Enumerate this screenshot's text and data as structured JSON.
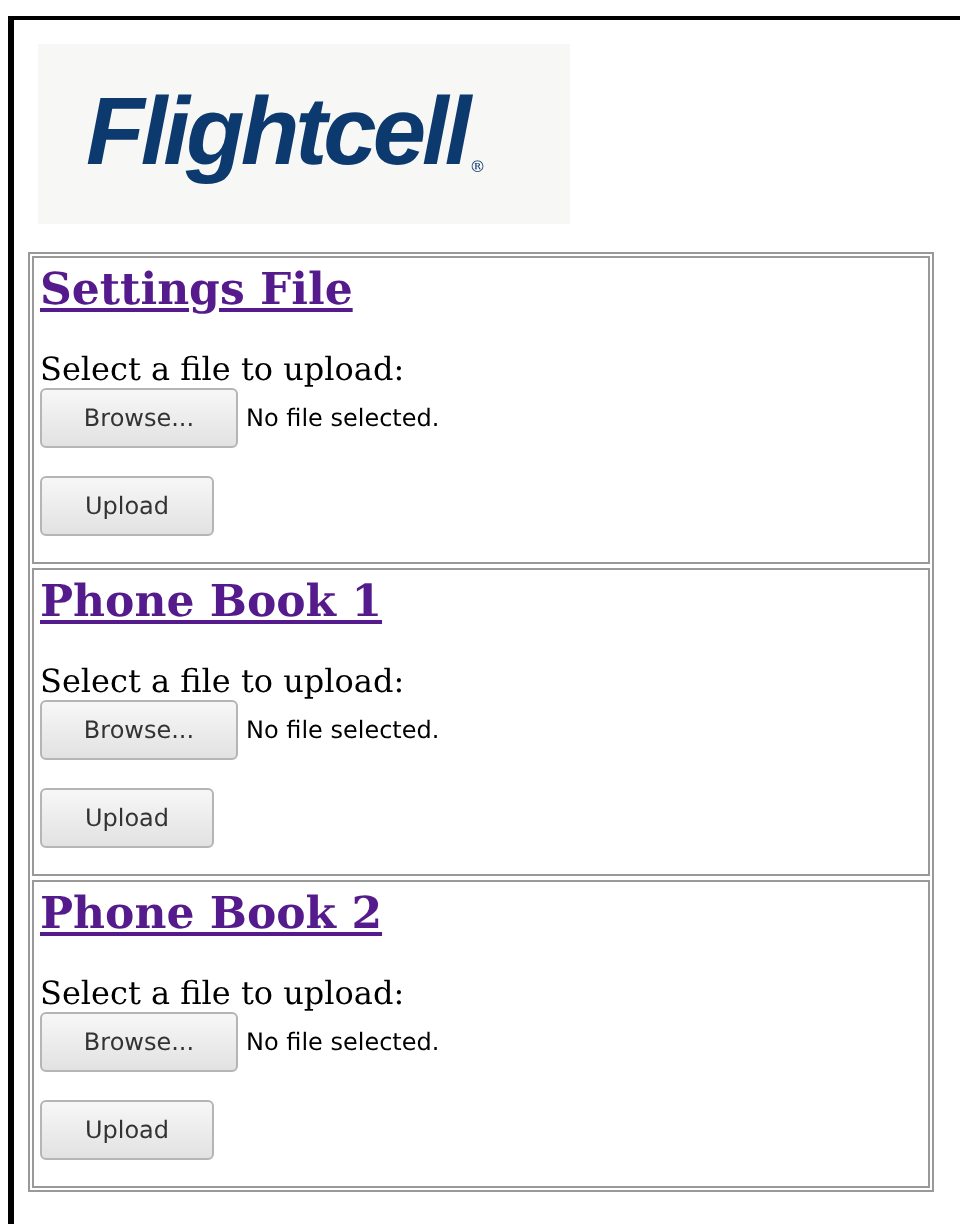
{
  "logo": {
    "name": "Flightcell",
    "mark": "®"
  },
  "sections": [
    {
      "title": "Settings File",
      "prompt": "Select a file to upload:",
      "browse_button": "Browse...",
      "file_status": "No file selected.",
      "upload_button": "Upload"
    },
    {
      "title": "Phone Book 1",
      "prompt": "Select a file to upload:",
      "browse_button": "Browse...",
      "file_status": "No file selected.",
      "upload_button": "Upload"
    },
    {
      "title": "Phone Book 2",
      "prompt": "Select a file to upload:",
      "browse_button": "Browse...",
      "file_status": "No file selected.",
      "upload_button": "Upload"
    }
  ]
}
